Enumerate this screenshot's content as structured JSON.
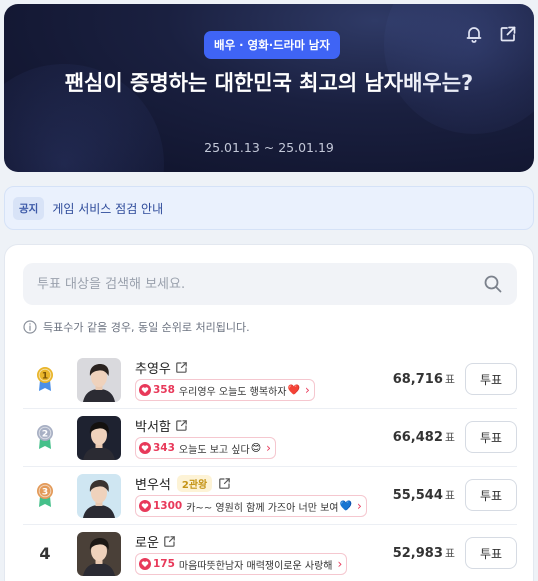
{
  "hero": {
    "category": "배우 · 영화·드라마 남자",
    "title": "팬심이 증명하는 대한민국 최고의 남자배우는?",
    "date_range": "25.01.13 ~ 25.01.19"
  },
  "notice": {
    "tag": "공지",
    "text": "게임 서비스 점검 안내"
  },
  "search": {
    "placeholder": "투표 대상을 검색해 보세요."
  },
  "info_text": "득표수가 같을 경우, 동일 순위로 처리됩니다.",
  "vote_unit": "표",
  "rows": [
    {
      "rank": "1",
      "medal": "gold",
      "name": "추영우",
      "award": "",
      "cheer_count": "358",
      "cheer_msg": "우리영우 오늘도 행복하자",
      "cheer_emoji": "❤️",
      "votes": "68,716",
      "button": "투표",
      "avatar_bg": "#d9d9dd",
      "hair": "#2a2320"
    },
    {
      "rank": "2",
      "medal": "silver",
      "name": "박서함",
      "award": "",
      "cheer_count": "343",
      "cheer_msg": "오늘도 보고 싶다",
      "cheer_emoji": "😊",
      "votes": "66,482",
      "button": "투표",
      "avatar_bg": "#1e2230",
      "hair": "#14110f"
    },
    {
      "rank": "3",
      "medal": "bronze",
      "name": "변우석",
      "award": "2관왕",
      "cheer_count": "1300",
      "cheer_msg": "카~~ 영원히 함께 가즈아 너만 보여",
      "cheer_emoji": "💙",
      "votes": "55,544",
      "button": "투표",
      "avatar_bg": "#cfe6f2",
      "hair": "#3a3330"
    },
    {
      "rank": "4",
      "medal": "",
      "name": "로운",
      "award": "",
      "cheer_count": "175",
      "cheer_msg": "마음따뜻한남자 매력쟁이로운 사랑해",
      "cheer_emoji": "",
      "votes": "52,983",
      "button": "투표",
      "avatar_bg": "#4a4038",
      "hair": "#1c1815"
    }
  ],
  "colors": {
    "accent_blue": "#3f64f5",
    "cheer_red": "#e8395a",
    "gold": "#e9b52a",
    "silver": "#a8b0c4",
    "bronze": "#e39a59"
  }
}
